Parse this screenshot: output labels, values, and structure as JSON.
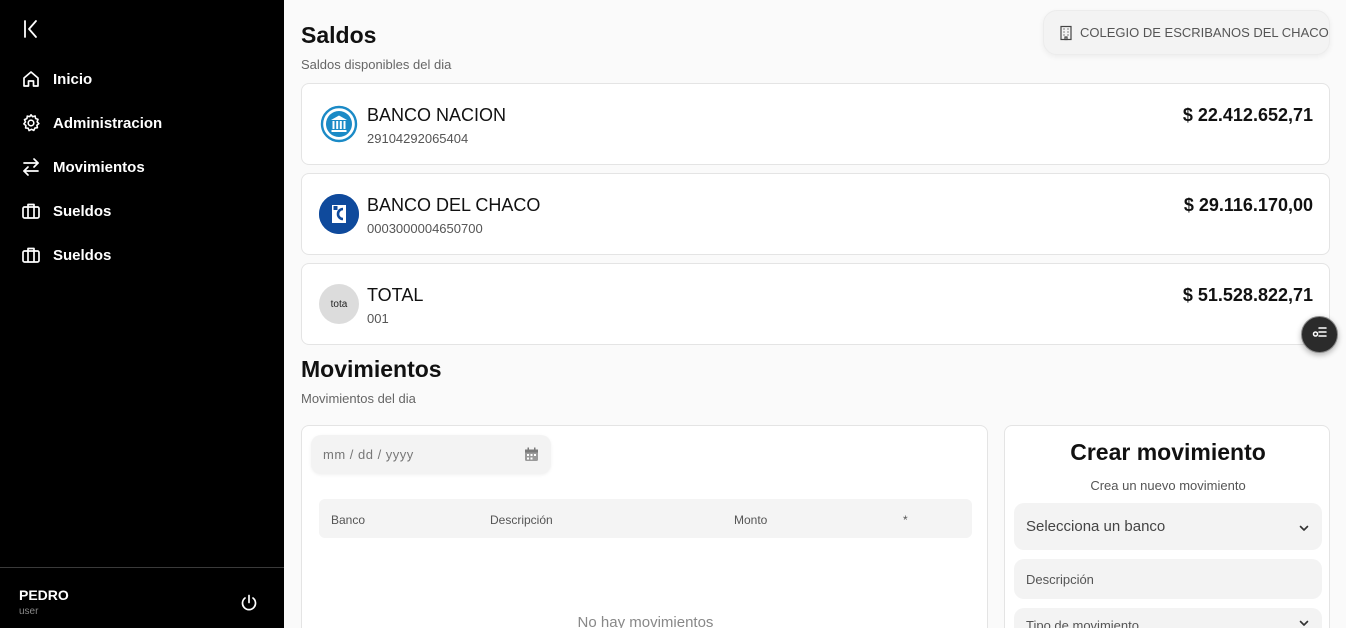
{
  "sidebar": {
    "items": [
      {
        "label": "Inicio",
        "icon": "home-icon"
      },
      {
        "label": "Administracion",
        "icon": "gear-icon"
      },
      {
        "label": "Movimientos",
        "icon": "arrows-swap-icon"
      },
      {
        "label": "Sueldos",
        "icon": "briefcase-icon"
      },
      {
        "label": "Sueldos",
        "icon": "briefcase-icon"
      }
    ],
    "user": {
      "name": "PEDRO",
      "role": "user"
    }
  },
  "header": {
    "org_name": "COLEGIO DE ESCRIBANOS DEL CHACO"
  },
  "saldos": {
    "title": "Saldos",
    "subtitle": "Saldos disponibles del dia",
    "accounts": [
      {
        "name": "BANCO NACION",
        "account": "29104292065404",
        "amount": "$ 22.412.652,71",
        "logo": "banco-nacion-logo"
      },
      {
        "name": "BANCO DEL CHACO",
        "account": "0003000004650700",
        "amount": "$ 29.116.170,00",
        "logo": "banco-chaco-logo"
      },
      {
        "name": "TOTAL",
        "account": "001",
        "amount": "$ 51.528.822,71",
        "logo_text": "tota"
      }
    ]
  },
  "movimientos": {
    "title": "Movimientos",
    "subtitle": "Movimientos del dia",
    "date_placeholder": "mm / dd / yyyy",
    "columns": [
      "Banco",
      "Descripción",
      "Monto",
      "*"
    ],
    "empty_text": "No hay movimientos"
  },
  "crear": {
    "title": "Crear movimiento",
    "subtitle": "Crea un nuevo movimiento",
    "bank_select": "Selecciona un banco",
    "description_placeholder": "Descripción",
    "type_select": "Tipo de movimiento"
  },
  "colors": {
    "sidebar_bg": "#000000",
    "page_bg": "#fafafa",
    "nacion_blue": "#1b8ac6",
    "chaco_blue": "#0f4a9c"
  }
}
